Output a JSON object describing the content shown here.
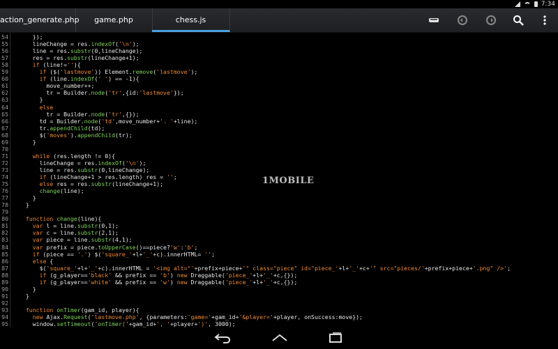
{
  "status": {
    "time": "7:34"
  },
  "tabs": [
    {
      "label": "action_generate.php",
      "active": false
    },
    {
      "label": "game.php",
      "active": false
    },
    {
      "label": "chess.js",
      "active": true
    }
  ],
  "toolbar": {
    "icons": [
      "save-icon",
      "undo-icon",
      "redo-icon",
      "search-icon",
      "overflow-menu-icon"
    ]
  },
  "watermark": "1MOBILE",
  "code": {
    "lines": [
      {
        "n": "54",
        "t": "    });"
      },
      {
        "n": "55",
        "t": "    lineChange = res.indexOf('\\n');"
      },
      {
        "n": "56",
        "t": "    line = res.substr(0,lineChange);"
      },
      {
        "n": "57",
        "t": "    res = res.substr(lineChange+1);"
      },
      {
        "n": "58",
        "t": "    if (line!=''){"
      },
      {
        "n": "59",
        "t": "      if ($('lastmove')) Element.remove('lastmove');"
      },
      {
        "n": "60",
        "t": "      if (line.indexOf(' ') == -1){"
      },
      {
        "n": "61",
        "t": "        move_number++;"
      },
      {
        "n": "62",
        "t": "        tr = Builder.node('tr',{id:'lastmove'});"
      },
      {
        "n": "63",
        "t": "      }"
      },
      {
        "n": "64",
        "t": "      else"
      },
      {
        "n": "65",
        "t": "        tr = Builder.node('tr',{});"
      },
      {
        "n": "66",
        "t": "      td = Builder.node('td',move_number+'. '+line);"
      },
      {
        "n": "67",
        "t": "      tr.appendChild(td);"
      },
      {
        "n": "68",
        "t": "      $('moves').appendChild(tr);"
      },
      {
        "n": "69",
        "t": "    }"
      },
      {
        "n": "70",
        "t": ""
      },
      {
        "n": "71",
        "t": "    while (res.length != 0){"
      },
      {
        "n": "72",
        "t": "      lineChange = res.indexOf('\\n');"
      },
      {
        "n": "73",
        "t": "      line = res.substr(0,lineChange);"
      },
      {
        "n": "74",
        "t": "      if (lineChange+1 > res.length) res = '';"
      },
      {
        "n": "75",
        "t": "      else res = res.substr(lineChange+1);"
      },
      {
        "n": "76",
        "t": "      change(line);"
      },
      {
        "n": "77",
        "t": "    }"
      },
      {
        "n": "78",
        "t": "  }"
      },
      {
        "n": "79",
        "t": ""
      },
      {
        "n": "80",
        "t": "  function change(line){"
      },
      {
        "n": "81",
        "t": "    var l = line.substr(0,1);"
      },
      {
        "n": "82",
        "t": "    var c = line.substr(2,1);"
      },
      {
        "n": "83",
        "t": "    var piece = line.substr(4,1);"
      },
      {
        "n": "84",
        "t": "    var prefix = piece.toUpperCase()==piece?'w':'b';"
      },
      {
        "n": "85",
        "t": "    if (piece == '.') $('square_'+l+'_'+c).innerHTML= '';"
      },
      {
        "n": "86",
        "t": "    else {"
      },
      {
        "n": "87",
        "t": "      $('square_'+l+'_'+c).innerHTML = '<img alt=\"'+prefix+piece+'\" class=\"piece\" id=\"piece_'+l+'_'+c+'\" src=\"pieces/'+prefix+piece+'.png\" />';"
      },
      {
        "n": "88",
        "t": "      if (g_player=='black' && prefix == 'b') new Draggable('piece_'+l+'_'+c,{});"
      },
      {
        "n": "89",
        "t": "      if (g_player=='white' && prefix == 'w') new Draggable('piece_'+l+'_'+c,{});"
      },
      {
        "n": "90",
        "t": "    }"
      },
      {
        "n": "91",
        "t": "  }"
      },
      {
        "n": "92",
        "t": ""
      },
      {
        "n": "93",
        "t": "  function onTimer(gam_id, player){"
      },
      {
        "n": "94",
        "t": "    new Ajax.Request('lastmove.php', {parameters:'game='+gam_id+'&player='+player, onSuccess:move});"
      },
      {
        "n": "95",
        "t": "    window.setTimeout('onTimer('+gam_id+', '+player+')', 3000);"
      }
    ]
  },
  "navbar": {
    "icons": [
      "back-icon",
      "home-icon",
      "recents-icon"
    ]
  }
}
